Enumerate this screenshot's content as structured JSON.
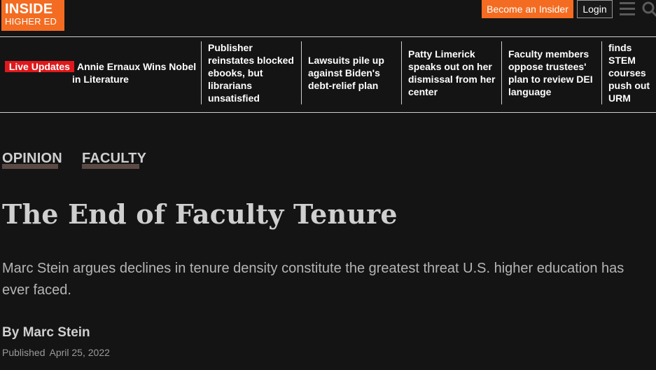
{
  "header": {
    "logo_line1": "INSIDE",
    "logo_line2": "HIGHER ED",
    "become_insider": "Become an Insider",
    "login": "Login",
    "menu_icon": "hamburger-menu-icon",
    "search_icon": "search-icon",
    "accent_color": "#f36c21"
  },
  "strip": {
    "live_badge": "Live Updates",
    "live_headline": "Annie Ernaux Wins Nobel in Literature",
    "live_badge_color": "#e0181b",
    "items": [
      {
        "text": "Publisher reinstates blocked ebooks, but librarians unsatisfied"
      },
      {
        "text": "Lawsuits pile up against Biden's debt-relief plan"
      },
      {
        "text": "Patty Limerick speaks out on her dismissal from her center"
      },
      {
        "text": "Faculty members oppose trustees' plan to review DEI language"
      },
      {
        "text": "Study finds STEM courses push out URM students"
      }
    ]
  },
  "article": {
    "tags": [
      "OPINION",
      "FACULTY"
    ],
    "title": "The End of Faculty Tenure",
    "dek": "Marc Stein argues declines in tenure density constitute the greatest threat U.S. higher education has ever faced.",
    "byline": "By Marc Stein",
    "published_label": "Published",
    "published_date": "April 25, 2022"
  }
}
